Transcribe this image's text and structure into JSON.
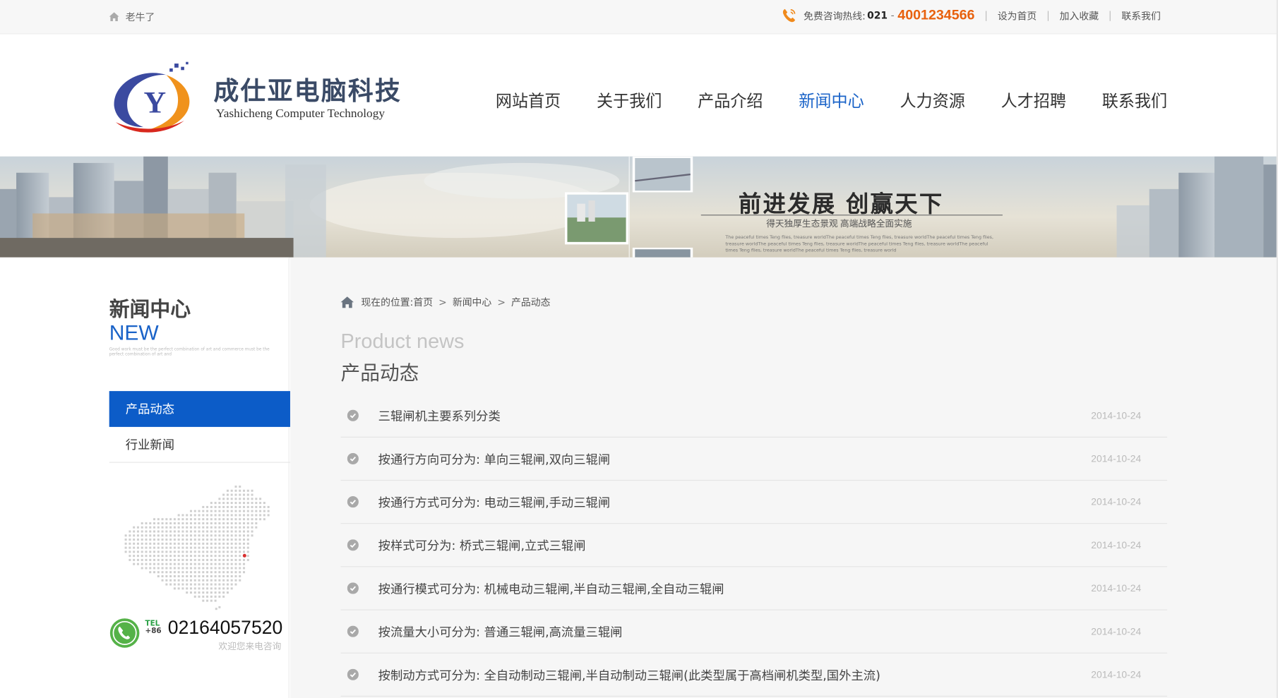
{
  "topbar": {
    "home_label": "老牛了",
    "hotline_label": "免费咨询热线:",
    "hotline_area": "021",
    "hotline_dash": "-",
    "hotline_number": "4001234566",
    "links": [
      "设为首页",
      "加入收藏",
      "联系我们"
    ],
    "separator": "|"
  },
  "brand": {
    "name_cn": "成仕亚电脑科技",
    "name_en": "Yashicheng Computer Technology",
    "logo_letter": "Y"
  },
  "nav": {
    "items": [
      "网站首页",
      "关于我们",
      "产品介绍",
      "新闻中心",
      "人力资源",
      "人才招聘",
      "联系我们"
    ],
    "active_index": 3
  },
  "banner": {
    "title": "前进发展 创赢天下",
    "subtitle": "得天独厚生态景观 高端战略全面实施",
    "fine_print": "The peaceful times Teng flies, treasure worldThe peaceful times Teng flies, treasure worldThe peaceful times Teng flies, treasure worldThe peaceful times Teng flies, treasure worldThe peaceful times Teng flies, treasure worldThe peaceful times Teng flies, treasure worldThe peaceful times Teng flies, treasure world"
  },
  "sidebar": {
    "title_cn": "新闻中心",
    "title_en": "NEW",
    "fine_print": "Good work must be the perfect combination of art and commerce must be the perfect combination of art and",
    "menu": [
      "产品动态",
      "行业新闻"
    ],
    "active_index": 0,
    "tel_tag": "TEL",
    "tel_prefix": "+86",
    "tel_number": "02164057520",
    "tel_note": "欢迎您来电咨询"
  },
  "breadcrumb": {
    "prefix": "现在的位置:",
    "items": [
      "首页",
      "新闻中心",
      "产品动态"
    ],
    "arrow": ">"
  },
  "section": {
    "title_en": "Product news",
    "title_cn": "产品动态"
  },
  "news": [
    {
      "title": "三辊闸机主要系列分类",
      "date": "2014-10-24"
    },
    {
      "title": "按通行方向可分为: 单向三辊闸,双向三辊闸",
      "date": "2014-10-24"
    },
    {
      "title": "按通行方式可分为: 电动三辊闸,手动三辊闸",
      "date": "2014-10-24"
    },
    {
      "title": "按样式可分为: 桥式三辊闸,立式三辊闸",
      "date": "2014-10-24"
    },
    {
      "title": "按通行模式可分为: 机械电动三辊闸,半自动三辊闸,全自动三辊闸",
      "date": "2014-10-24"
    },
    {
      "title": "按流量大小可分为: 普通三辊闸,高流量三辊闸",
      "date": "2014-10-24"
    },
    {
      "title": "按制动方式可分为: 全自动制动三辊闸,半自动制动三辊闸(此类型属于高档闸机类型,国外主流)",
      "date": "2014-10-24"
    }
  ],
  "colors": {
    "accent": "#1a63c8",
    "active_bg": "#0c5cc8",
    "hotline": "#e8610e"
  }
}
